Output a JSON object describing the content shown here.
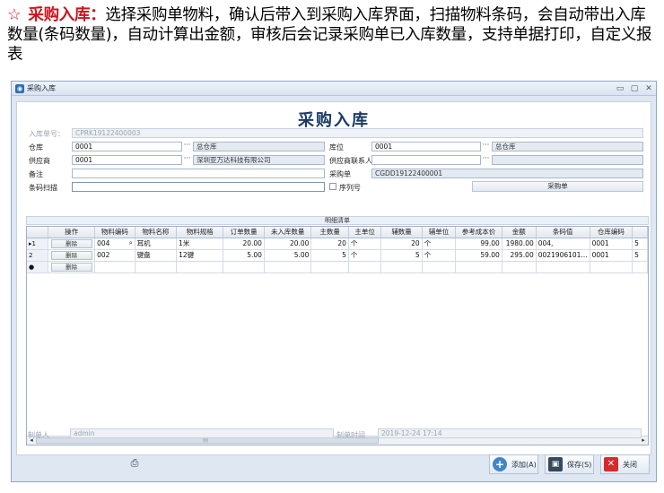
{
  "description": {
    "star": "☆",
    "title": "采购入库：",
    "body": "选择采购单物料，确认后带入到采购入库界面，扫描物料条码，会自动带出入库数量(条码数量)，自动计算出金额，审核后会记录采购单已入库数量，支持单据打印，自定义报表"
  },
  "window": {
    "title": "采购入库",
    "minimize": "▭",
    "restore": "▢",
    "close": "✕"
  },
  "form": {
    "title": "采购入库",
    "order_no_label": "入库单号：",
    "order_no": "CPRK19122400003",
    "warehouse_label": "仓库",
    "warehouse_code": "0001",
    "warehouse_name": "总仓库",
    "location_label": "库位",
    "location_code": "0001",
    "location_name": "总仓库",
    "supplier_label": "供应商",
    "supplier_code": "0001",
    "supplier_name": "深圳亚万达科技有限公司",
    "contact_label": "供应商联系人",
    "contact_value": "",
    "remark_label": "备注",
    "remark_value": "",
    "po_label": "采购单",
    "po_value": "CGDD19122400001",
    "barcode_label": "条码扫描",
    "barcode_value": "",
    "serial_label": "序列号",
    "po_button": "采购单",
    "dots": "···"
  },
  "grid": {
    "caption": "明细清单",
    "columns": [
      "操作",
      "物料编码",
      "物料名称",
      "物料规格",
      "订单数量",
      "未入库数量",
      "主数量",
      "主单位",
      "辅数量",
      "辅单位",
      "参考成本价",
      "金额",
      "条码值",
      "仓库编码",
      ""
    ],
    "delete_label": "删除",
    "rows": [
      {
        "ind": "▸1",
        "code": "004",
        "name": "耳机",
        "spec": "1米",
        "order_qty": "20.00",
        "pending_qty": "20.00",
        "main_qty": "20",
        "main_unit": "个",
        "aux_qty": "20",
        "aux_unit": "个",
        "cost": "99.00",
        "amount": "1980.00",
        "barcode": "004,",
        "wh_code": "0001",
        "extra": "5"
      },
      {
        "ind": "2",
        "code": "002",
        "name": "键盘",
        "spec": "12键",
        "order_qty": "5.00",
        "pending_qty": "5.00",
        "main_qty": "5",
        "main_unit": "个",
        "aux_qty": "5",
        "aux_unit": "个",
        "cost": "59.00",
        "amount": "295.00",
        "barcode": "0021906101...",
        "wh_code": "0001",
        "extra": "5"
      },
      {
        "ind": "●",
        "code": "",
        "name": "",
        "spec": "",
        "order_qty": "",
        "pending_qty": "",
        "main_qty": "",
        "main_unit": "",
        "aux_qty": "",
        "aux_unit": "",
        "cost": "",
        "amount": "",
        "barcode": "",
        "wh_code": "",
        "extra": ""
      }
    ]
  },
  "footer": {
    "maker_label": "制单人",
    "maker_value": "admin",
    "time_label": "制单时间",
    "time_value": "2019-12-24 17:14",
    "add_button": "添加(A)",
    "save_button": "保存(S)",
    "close_button": "关闭"
  }
}
